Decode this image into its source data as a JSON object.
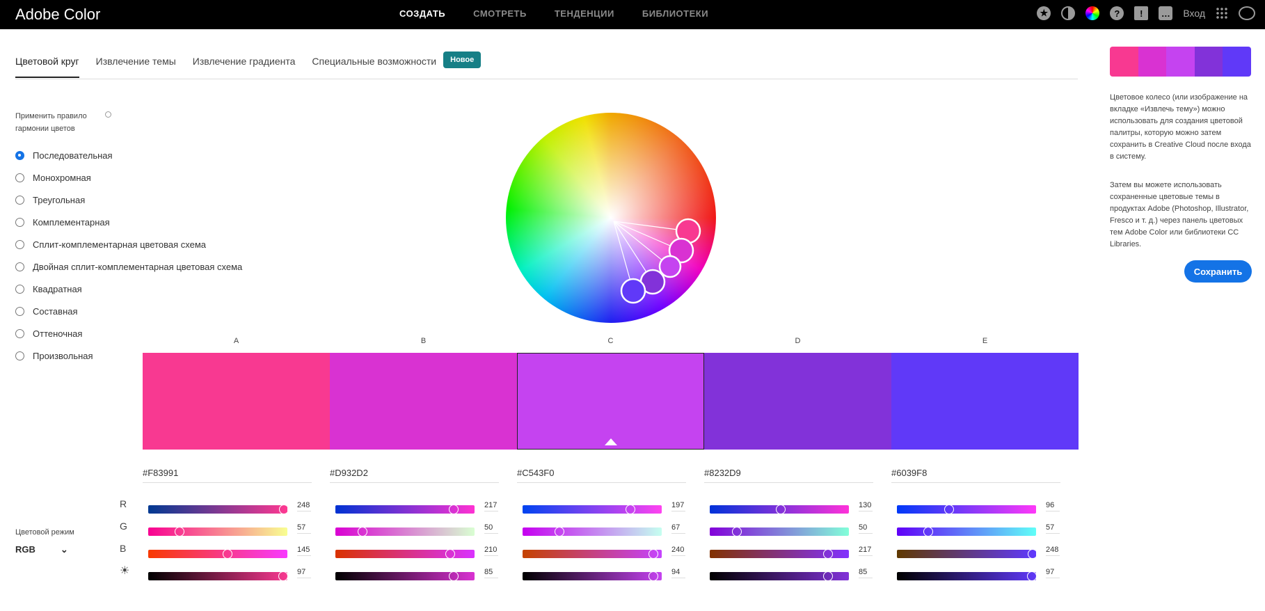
{
  "header": {
    "logo": "Adobe Color",
    "nav": [
      "СОЗДАТЬ",
      "СМОТРЕТЬ",
      "ТЕНДЕНЦИИ",
      "БИБЛИОТЕКИ"
    ],
    "login": "Вход"
  },
  "tabs": [
    "Цветовой круг",
    "Извлечение темы",
    "Извлечение градиента",
    "Специальные возможности"
  ],
  "badge": "Новое",
  "harmony": {
    "title": "Применить правило гармонии цветов",
    "options": [
      "Последовательная",
      "Монохромная",
      "Треугольная",
      "Комплементарная",
      "Сплит-комплементарная цветовая схема",
      "Двойная сплит-комплементарная цветовая схема",
      "Квадратная",
      "Составная",
      "Оттеночная",
      "Произвольная"
    ],
    "selected": 0
  },
  "colors": [
    {
      "label": "A",
      "hex": "#F83991",
      "r": 248,
      "g": 57,
      "b": 145,
      "br": 97
    },
    {
      "label": "B",
      "hex": "#D932D2",
      "r": 217,
      "g": 50,
      "b": 210,
      "br": 85
    },
    {
      "label": "C",
      "hex": "#C543F0",
      "r": 197,
      "g": 67,
      "b": 240,
      "br": 94
    },
    {
      "label": "D",
      "hex": "#8232D9",
      "r": 130,
      "g": 50,
      "b": 217,
      "br": 85
    },
    {
      "label": "E",
      "hex": "#6039F8",
      "r": 96,
      "g": 57,
      "b": 248,
      "br": 97
    }
  ],
  "selected_color": 2,
  "channels": [
    "R",
    "G",
    "B"
  ],
  "color_mode": {
    "label": "Цветовой режим",
    "value": "RGB"
  },
  "right": {
    "p1": "Цветовое колесо (или изображение на вкладке «Извлечь тему») можно использовать для создания цветовой палитры, которую можно затем сохранить в Creative Cloud после входа в систему.",
    "p2": "Затем вы можете использовать сохраненные цветовые темы в продуктах Adobe (Photoshop, Illustrator, Fresco и т. д.) через панель цветовых тем Adobe Color или библиотеки CC Libraries.",
    "save": "Сохранить"
  }
}
